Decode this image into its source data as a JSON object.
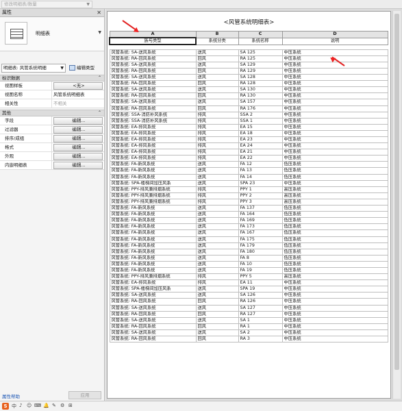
{
  "context_bar": {
    "value": "修改明细表/数量"
  },
  "properties": {
    "title": "属性",
    "type_name": "明细表",
    "instance_selector": "明细表: 风管系统明细",
    "edit_type_label": "编辑类型",
    "categories": [
      {
        "name": "标识数据",
        "rows": [
          {
            "key": "视图样板",
            "value": "<无>",
            "kind": "button"
          },
          {
            "key": "视图名称",
            "value": "风管系统明细表",
            "kind": "text"
          },
          {
            "key": "相关性",
            "value": "不相关",
            "kind": "dim"
          }
        ]
      },
      {
        "name": "其他",
        "rows": [
          {
            "key": "字段",
            "value": "编辑...",
            "kind": "button"
          },
          {
            "key": "过滤器",
            "value": "编辑...",
            "kind": "button"
          },
          {
            "key": "排序/成组",
            "value": "编辑...",
            "kind": "button"
          },
          {
            "key": "格式",
            "value": "编辑...",
            "kind": "button"
          },
          {
            "key": "外观",
            "value": "编辑...",
            "kind": "button"
          },
          {
            "key": "内嵌明细表",
            "value": "编辑...",
            "kind": "button"
          }
        ]
      }
    ],
    "help_link": "属性帮助",
    "apply_button": "应用"
  },
  "schedule": {
    "title": "<风管系统明细表>",
    "column_letters": [
      "A",
      "B",
      "C",
      "D"
    ],
    "column_headers": [
      "族与类型",
      "系统分类",
      "系统名称",
      "说明"
    ],
    "rows": [
      [
        "风管系统: SA-送风系统",
        "送风",
        "SA 125",
        "中压系统"
      ],
      [
        "风管系统: RA-回风系统",
        "回风",
        "RA 125",
        "中压系统"
      ],
      [
        "风管系统: SA-送风系统",
        "送风",
        "SA 129",
        "中压系统"
      ],
      [
        "风管系统: RA-回风系统",
        "回风",
        "RA 129",
        "中压系统"
      ],
      [
        "风管系统: SA-送风系统",
        "送风",
        "SA 128",
        "中压系统"
      ],
      [
        "风管系统: RA-回风系统",
        "回风",
        "RA 128",
        "中压系统"
      ],
      [
        "风管系统: SA-送风系统",
        "送风",
        "SA 130",
        "中压系统"
      ],
      [
        "风管系统: RA-回风系统",
        "回风",
        "RA 130",
        "中压系统"
      ],
      [
        "风管系统: SA-送风系统",
        "送风",
        "SA 157",
        "中压系统"
      ],
      [
        "风管系统: RA-回风系统",
        "回风",
        "RA 176",
        "中压系统"
      ],
      [
        "风管系统: SSA-消防补风系统",
        "排风",
        "SSA 2",
        "中压系统"
      ],
      [
        "风管系统: SSA-消防补风系统",
        "排风",
        "SSA 1",
        "中压系统"
      ],
      [
        "风管系统: EA-排风系统",
        "排风",
        "EA 15",
        "中压系统"
      ],
      [
        "风管系统: EA-排风系统",
        "排风",
        "EA 18",
        "中压系统"
      ],
      [
        "风管系统: EA-排风系统",
        "排风",
        "EA 23",
        "中压系统"
      ],
      [
        "风管系统: EA-排风系统",
        "排风",
        "EA 24",
        "中压系统"
      ],
      [
        "风管系统: EA-排风系统",
        "排风",
        "EA 21",
        "中压系统"
      ],
      [
        "风管系统: EA-排风系统",
        "排风",
        "EA 22",
        "中压系统"
      ],
      [
        "风管系统: FA-新风系统",
        "送风",
        "FA 12",
        "低压系统"
      ],
      [
        "风管系统: FA-新风系统",
        "送风",
        "FA 13",
        "低压系统"
      ],
      [
        "风管系统: FA-新风系统",
        "送风",
        "FA 14",
        "低压系统"
      ],
      [
        "风管系统: SPA-楼梯间加压风系",
        "送风",
        "SPA 23",
        "中压系统"
      ],
      [
        "风管系统: PPY-排风兼排烟系统",
        "排风",
        "PPY 1",
        "高压系统"
      ],
      [
        "风管系统: PPY-排风兼排烟系统",
        "排风",
        "PPY 2",
        "高压系统"
      ],
      [
        "风管系统: PPY-排风兼排烟系统",
        "排风",
        "PPY 3",
        "高压系统"
      ],
      [
        "风管系统: FA-新风系统",
        "送风",
        "FA 137",
        "低压系统"
      ],
      [
        "风管系统: FA-新风系统",
        "送风",
        "FA 164",
        "低压系统"
      ],
      [
        "风管系统: FA-新风系统",
        "送风",
        "FA 169",
        "低压系统"
      ],
      [
        "风管系统: FA-新风系统",
        "送风",
        "FA 173",
        "低压系统"
      ],
      [
        "风管系统: FA-新风系统",
        "送风",
        "FA 167",
        "低压系统"
      ],
      [
        "风管系统: FA-新风系统",
        "送风",
        "FA 175",
        "低压系统"
      ],
      [
        "风管系统: FA-新风系统",
        "送风",
        "FA 179",
        "低压系统"
      ],
      [
        "风管系统: FA-新风系统",
        "送风",
        "FA 180",
        "低压系统"
      ],
      [
        "风管系统: FA-新风系统",
        "送风",
        "FA 8",
        "低压系统"
      ],
      [
        "风管系统: FA-新风系统",
        "送风",
        "FA 10",
        "低压系统"
      ],
      [
        "风管系统: FA-新风系统",
        "送风",
        "FA 19",
        "低压系统"
      ],
      [
        "风管系统: PPY-排风兼排烟系统",
        "排风",
        "PPY 5",
        "高压系统"
      ],
      [
        "风管系统: EA-排风系统",
        "排风",
        "EA 11",
        "中压系统"
      ],
      [
        "风管系统: SPA-楼梯间加压风系",
        "送风",
        "SPA 19",
        "中压系统"
      ],
      [
        "风管系统: SA-送风系统",
        "送风",
        "SA 126",
        "中压系统"
      ],
      [
        "风管系统: RA-回风系统",
        "回风",
        "RA 126",
        "中压系统"
      ],
      [
        "风管系统: SA-送风系统",
        "送风",
        "SA 127",
        "中压系统"
      ],
      [
        "风管系统: RA-回风系统",
        "回风",
        "RA 127",
        "中压系统"
      ],
      [
        "风管系统: SA-送风系统",
        "送风",
        "SA 1",
        "中压系统"
      ],
      [
        "风管系统: RA-回风系统",
        "回风",
        "RA 1",
        "中压系统"
      ],
      [
        "风管系统: SA-送风系统",
        "送风",
        "SA 2",
        "中压系统"
      ],
      [
        "风管系统: RA-回风系统",
        "回风",
        "RA 3",
        "中压系统"
      ]
    ]
  },
  "colors": {
    "annotation_arrow": "#e22222",
    "help_link": "#1f58b5"
  },
  "taskbar": {
    "logo": "S",
    "icons": [
      "中",
      "♪",
      "☺",
      "⌨",
      "🔔",
      "✎",
      "⚙",
      "⊞"
    ]
  }
}
